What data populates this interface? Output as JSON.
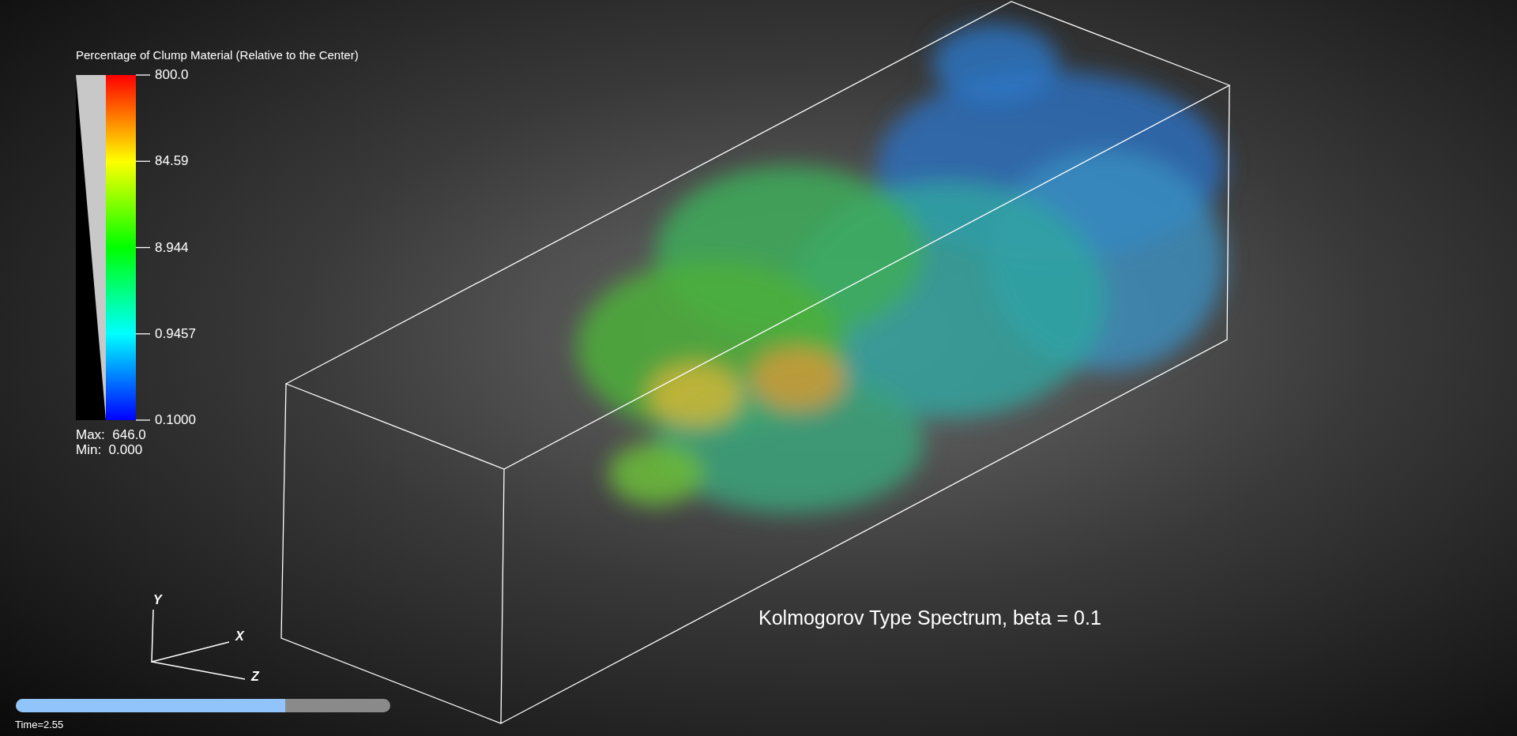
{
  "legend": {
    "title": "Percentage of Clump Material (Relative to the Center)",
    "ticks": [
      "800.0",
      "84.59",
      "8.944",
      "0.9457",
      "0.1000"
    ],
    "max": "Max:  646.0",
    "min": "Min:  0.000"
  },
  "axes": {
    "y": "Y",
    "x": "X",
    "z": "Z"
  },
  "caption": "Kolmogorov Type Spectrum, beta = 0.1",
  "time_slider": {
    "level": 0.72,
    "label": "Time=2.55"
  }
}
